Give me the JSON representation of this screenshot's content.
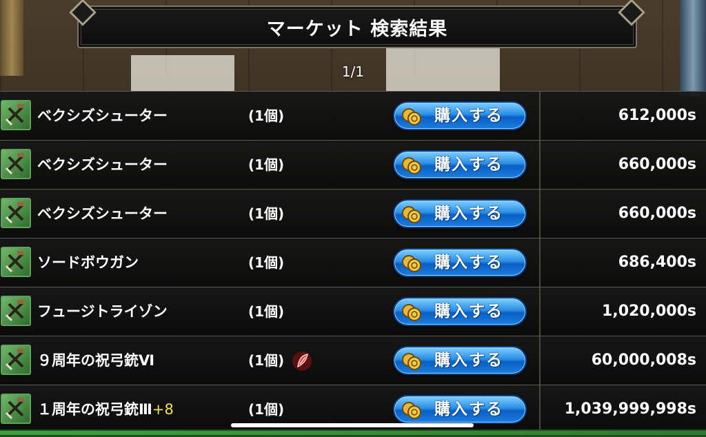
{
  "header": {
    "title": "マーケット 検索結果"
  },
  "pagination": {
    "page": "1/1"
  },
  "listings": [
    {
      "name": "ベクシズシューター",
      "plus": "",
      "qty": "(1個)",
      "buy_label": "購入する",
      "price": "612,000s",
      "gem": false
    },
    {
      "name": "ベクシズシューター",
      "plus": "",
      "qty": "(1個)",
      "buy_label": "購入する",
      "price": "660,000s",
      "gem": false
    },
    {
      "name": "ベクシズシューター",
      "plus": "",
      "qty": "(1個)",
      "buy_label": "購入する",
      "price": "660,000s",
      "gem": false
    },
    {
      "name": "ソードボウガン",
      "plus": "",
      "qty": "(1個)",
      "buy_label": "購入する",
      "price": "686,400s",
      "gem": false
    },
    {
      "name": "フュージトライゾン",
      "plus": "",
      "qty": "(1個)",
      "buy_label": "購入する",
      "price": "1,020,000s",
      "gem": false
    },
    {
      "name": "９周年の祝弓銃Ⅵ",
      "plus": "",
      "qty": "(1個)",
      "buy_label": "購入する",
      "price": "60,000,008s",
      "gem": true
    },
    {
      "name": "１周年の祝弓銃Ⅲ",
      "plus": "+8",
      "qty": "(1個)",
      "buy_label": "購入する",
      "price": "1,039,999,998s",
      "gem": false
    }
  ],
  "icons": {
    "item": "crossbow-icon",
    "coin": "coin-icon",
    "gem": "red-gem-icon"
  },
  "colors": {
    "button_blue": "#1c7fe0",
    "icon_green": "#5fa35a",
    "plus_yellow": "#f5e24a"
  }
}
